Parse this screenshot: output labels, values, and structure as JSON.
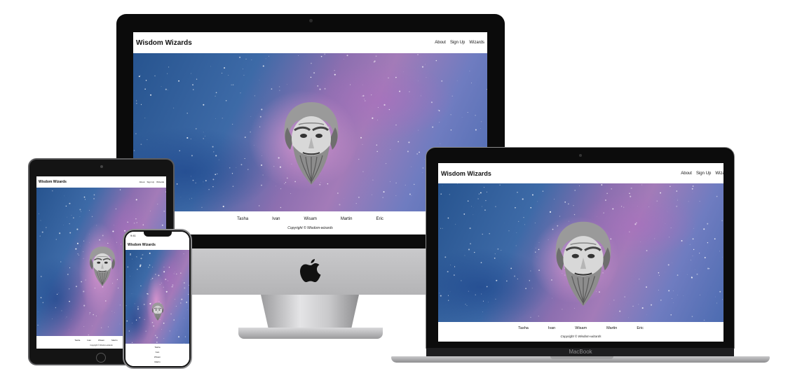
{
  "site": {
    "title": "Wisdom Wizards",
    "nav": [
      "About",
      "Sign Up",
      "Wizards"
    ],
    "names": [
      "Tasha",
      "Ivan",
      "Wisam",
      "Martin",
      "Eric"
    ],
    "copyright": "Copyright © Wisdom-wizards"
  },
  "macbook": {
    "label": "MacBook"
  },
  "iphone": {
    "time": "9:41"
  },
  "icons": {
    "apple": "apple-logo-icon",
    "hero": "wizard-portrait-icon"
  },
  "colors": {
    "bezel": "#0b0b0b",
    "space_blue": "#3d6aa7",
    "space_pink": "#eba0d7",
    "text": "#111111"
  }
}
